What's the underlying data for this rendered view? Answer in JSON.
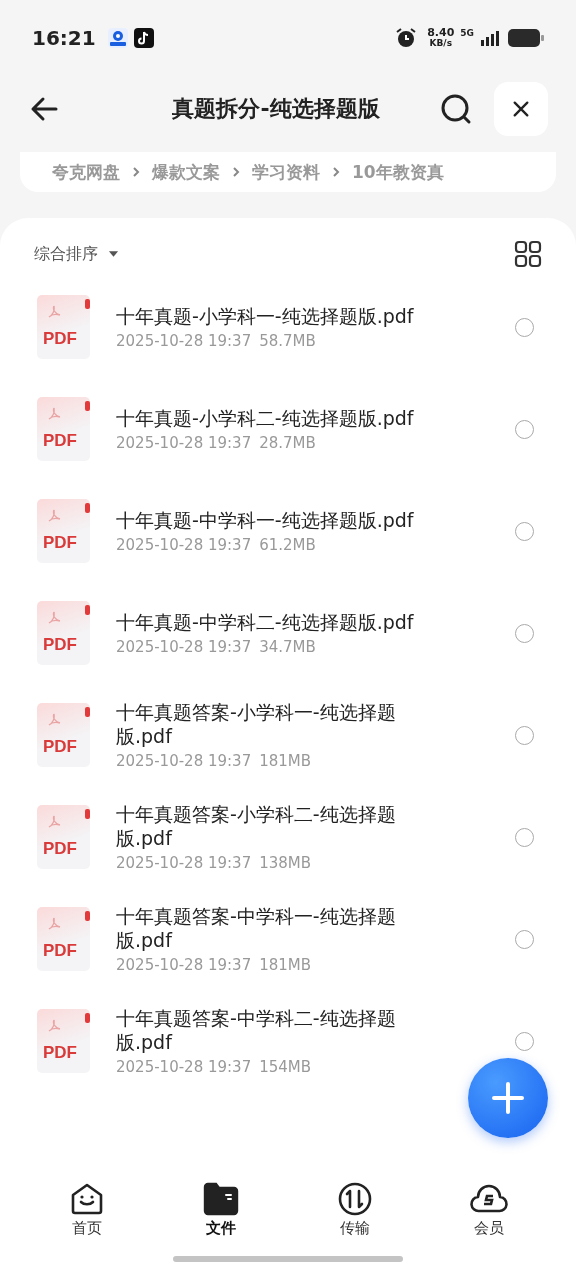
{
  "status_bar": {
    "time": "16:21",
    "speed": "8.40",
    "speed_unit": "KB/s",
    "network": "5G"
  },
  "header": {
    "title": "真题拆分-纯选择题版"
  },
  "breadcrumb": [
    "夸克网盘",
    "爆款文案",
    "学习资料",
    "10年教资真"
  ],
  "sort": {
    "label": "综合排序"
  },
  "files": [
    {
      "name": "十年真题-小学科一-纯选择题版.pdf",
      "badge": "PDF",
      "date": "2025-10-28 19:37",
      "size": "58.7MB",
      "selected": false
    },
    {
      "name": "十年真题-小学科二-纯选择题版.pdf",
      "badge": "PDF",
      "date": "2025-10-28 19:37",
      "size": "28.7MB",
      "selected": false
    },
    {
      "name": "十年真题-中学科一-纯选择题版.pdf",
      "badge": "PDF",
      "date": "2025-10-28 19:37",
      "size": "61.2MB",
      "selected": false
    },
    {
      "name": "十年真题-中学科二-纯选择题版.pdf",
      "badge": "PDF",
      "date": "2025-10-28 19:37",
      "size": "34.7MB",
      "selected": false
    },
    {
      "name": "十年真题答案-小学科一-纯选择题版.pdf",
      "badge": "PDF",
      "date": "2025-10-28 19:37",
      "size": "181MB",
      "selected": false
    },
    {
      "name": "十年真题答案-小学科二-纯选择题版.pdf",
      "badge": "PDF",
      "date": "2025-10-28 19:37",
      "size": "138MB",
      "selected": false
    },
    {
      "name": "十年真题答案-中学科一-纯选择题版.pdf",
      "badge": "PDF",
      "date": "2025-10-28 19:37",
      "size": "181MB",
      "selected": false
    },
    {
      "name": "十年真题答案-中学科二-纯选择题版.pdf",
      "badge": "PDF",
      "date": "2025-10-28 19:37",
      "size": "154MB",
      "selected": false
    }
  ],
  "tabs": [
    {
      "label": "首页",
      "kind": "home",
      "selected": false
    },
    {
      "label": "文件",
      "kind": "files",
      "selected": true
    },
    {
      "label": "传输",
      "kind": "transfer",
      "selected": false
    },
    {
      "label": "会员",
      "kind": "member",
      "selected": false
    }
  ]
}
